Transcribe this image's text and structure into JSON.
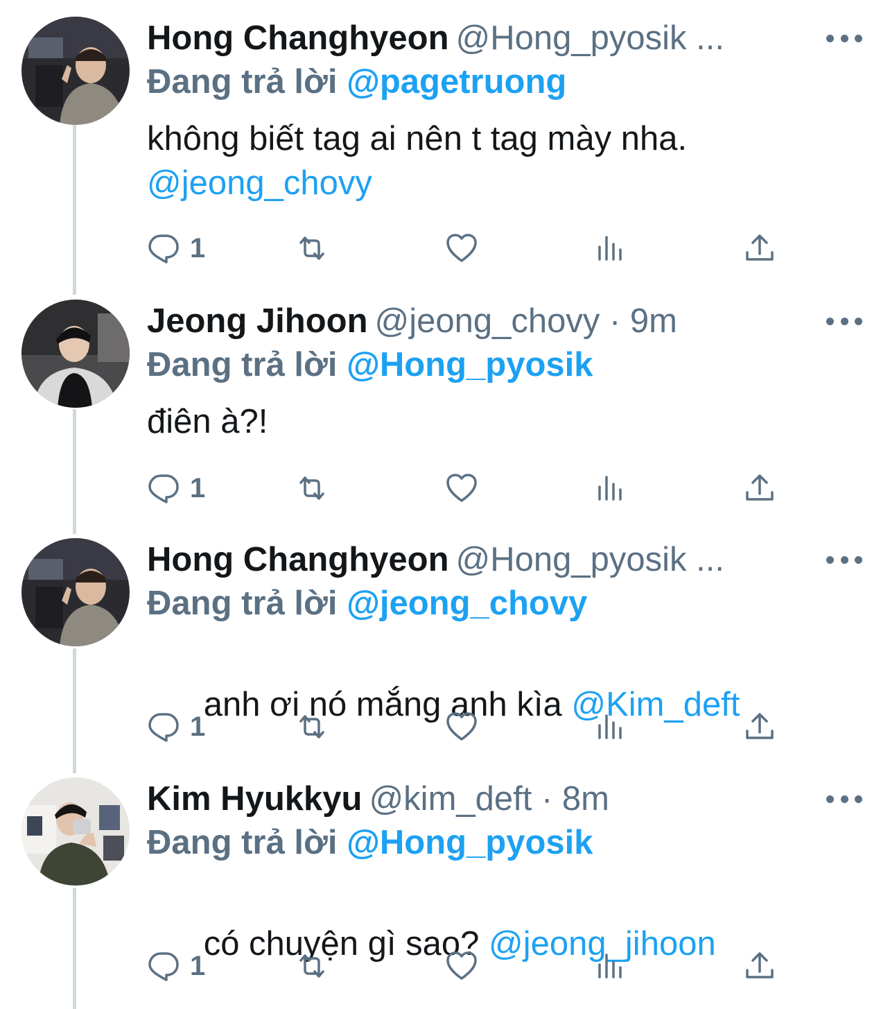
{
  "tweets": [
    {
      "display_name": "Hong Changhyeon",
      "meta": "@Hong_pyosik ...",
      "reply_prefix": "Đang trả lời",
      "reply_mention": "@pagetruong",
      "text": "không biết tag ai nên t tag mày nha.",
      "text_mention": "@jeong_chovy",
      "reply_count": "1"
    },
    {
      "display_name": "Jeong Jihoon",
      "meta": "@jeong_chovy · 9m",
      "reply_prefix": "Đang trả lời",
      "reply_mention": "@Hong_pyosik",
      "text": "điên à?!",
      "text_mention": "",
      "reply_count": "1"
    },
    {
      "display_name": "Hong Changhyeon",
      "meta": "@Hong_pyosik ...",
      "reply_prefix": "Đang trả lời",
      "reply_mention": "@jeong_chovy",
      "text": "anh ơi nó mắng anh kìa ",
      "text_mention": "@Kim_deft",
      "reply_count": "1"
    },
    {
      "display_name": "Kim Hyukkyu",
      "meta": "@kim_deft · 8m",
      "reply_prefix": "Đang trả lời",
      "reply_mention": "@Hong_pyosik",
      "text": "có chuyện gì sao? ",
      "text_mention": "@jeong_jihoon",
      "reply_count": "1"
    }
  ],
  "icons": {
    "reply": "reply-icon",
    "retweet": "retweet-icon",
    "like": "heart-icon",
    "analytics": "analytics-icon",
    "share": "share-icon",
    "more": "more-icon"
  },
  "colors": {
    "text_primary": "#14171a",
    "text_secondary": "#5b7083",
    "mention": "#1da1f2",
    "thread_line": "#cfd9de"
  }
}
